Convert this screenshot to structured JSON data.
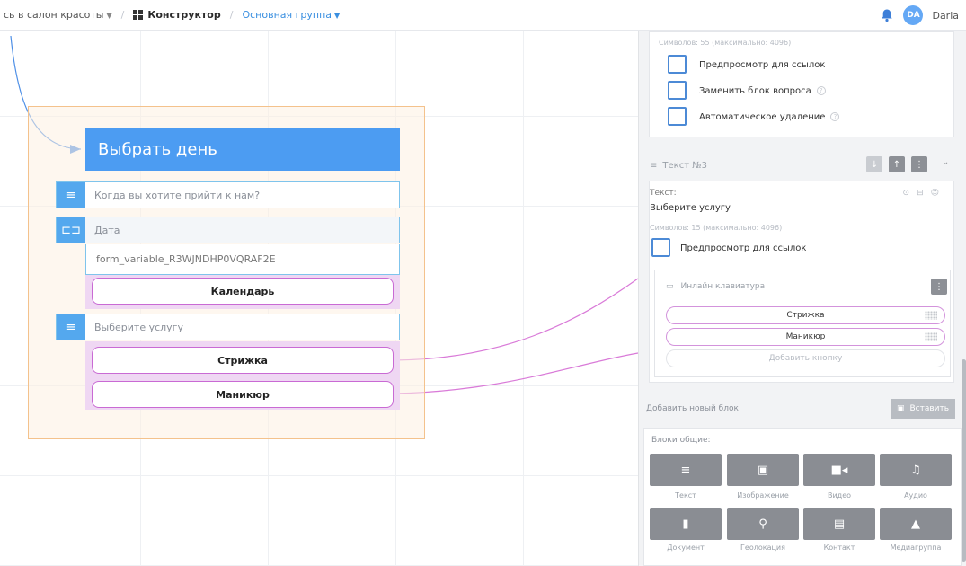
{
  "header": {
    "crumb_project": "сь в салон красоты",
    "crumb_constructor": "Конструктор",
    "crumb_group": "Основная группа",
    "user_initials": "DA",
    "user_name": "Daria"
  },
  "canvas": {
    "title_block": "Выбрать день",
    "question_text": "Когда вы хотите прийти к нам?",
    "date_label": "Дата",
    "form_variable": "form_variable_R3WJNDHP0VQRAF2E",
    "calendar_button": "Календарь",
    "service_text": "Выберите услугу",
    "service_buttons": [
      "Стрижка",
      "Маникюр"
    ]
  },
  "panel": {
    "prev_char_count": "Символов: 55 (максимально: 4096)",
    "checkboxes": [
      "Предпросмотр для ссылок",
      "Заменить блок вопроса",
      "Автоматическое удаление"
    ],
    "text_section_title": "Текст №3",
    "text_label": "Текст:",
    "text_value": "Выберите услугу",
    "char_count": "Символов: 15 (максимально: 4096)",
    "preview_checkbox": "Предпросмотр для ссылок",
    "inline_keyboard_title": "Инлайн клавиатура",
    "keyboard_buttons": [
      "Стрижка",
      "Маникюр"
    ],
    "add_button": "Добавить кнопку",
    "add_block_label": "Добавить новый блок",
    "paste_button": "Вставить",
    "blocks_general_label": "Блоки общие:",
    "blocks": [
      {
        "label": "Текст",
        "icon": "text-icon"
      },
      {
        "label": "Изображение",
        "icon": "image-icon"
      },
      {
        "label": "Видео",
        "icon": "video-icon"
      },
      {
        "label": "Аудио",
        "icon": "audio-icon"
      },
      {
        "label": "Документ",
        "icon": "document-icon"
      },
      {
        "label": "Геолокация",
        "icon": "geolocation-icon"
      },
      {
        "label": "Контакт",
        "icon": "contact-icon"
      },
      {
        "label": "Медиагруппа",
        "icon": "mediagroup-icon"
      }
    ]
  },
  "colors": {
    "accent_blue": "#4c9cf2",
    "group_border": "#f4c28c",
    "button_border": "#c96ad4",
    "connector": "#d97ad8"
  }
}
